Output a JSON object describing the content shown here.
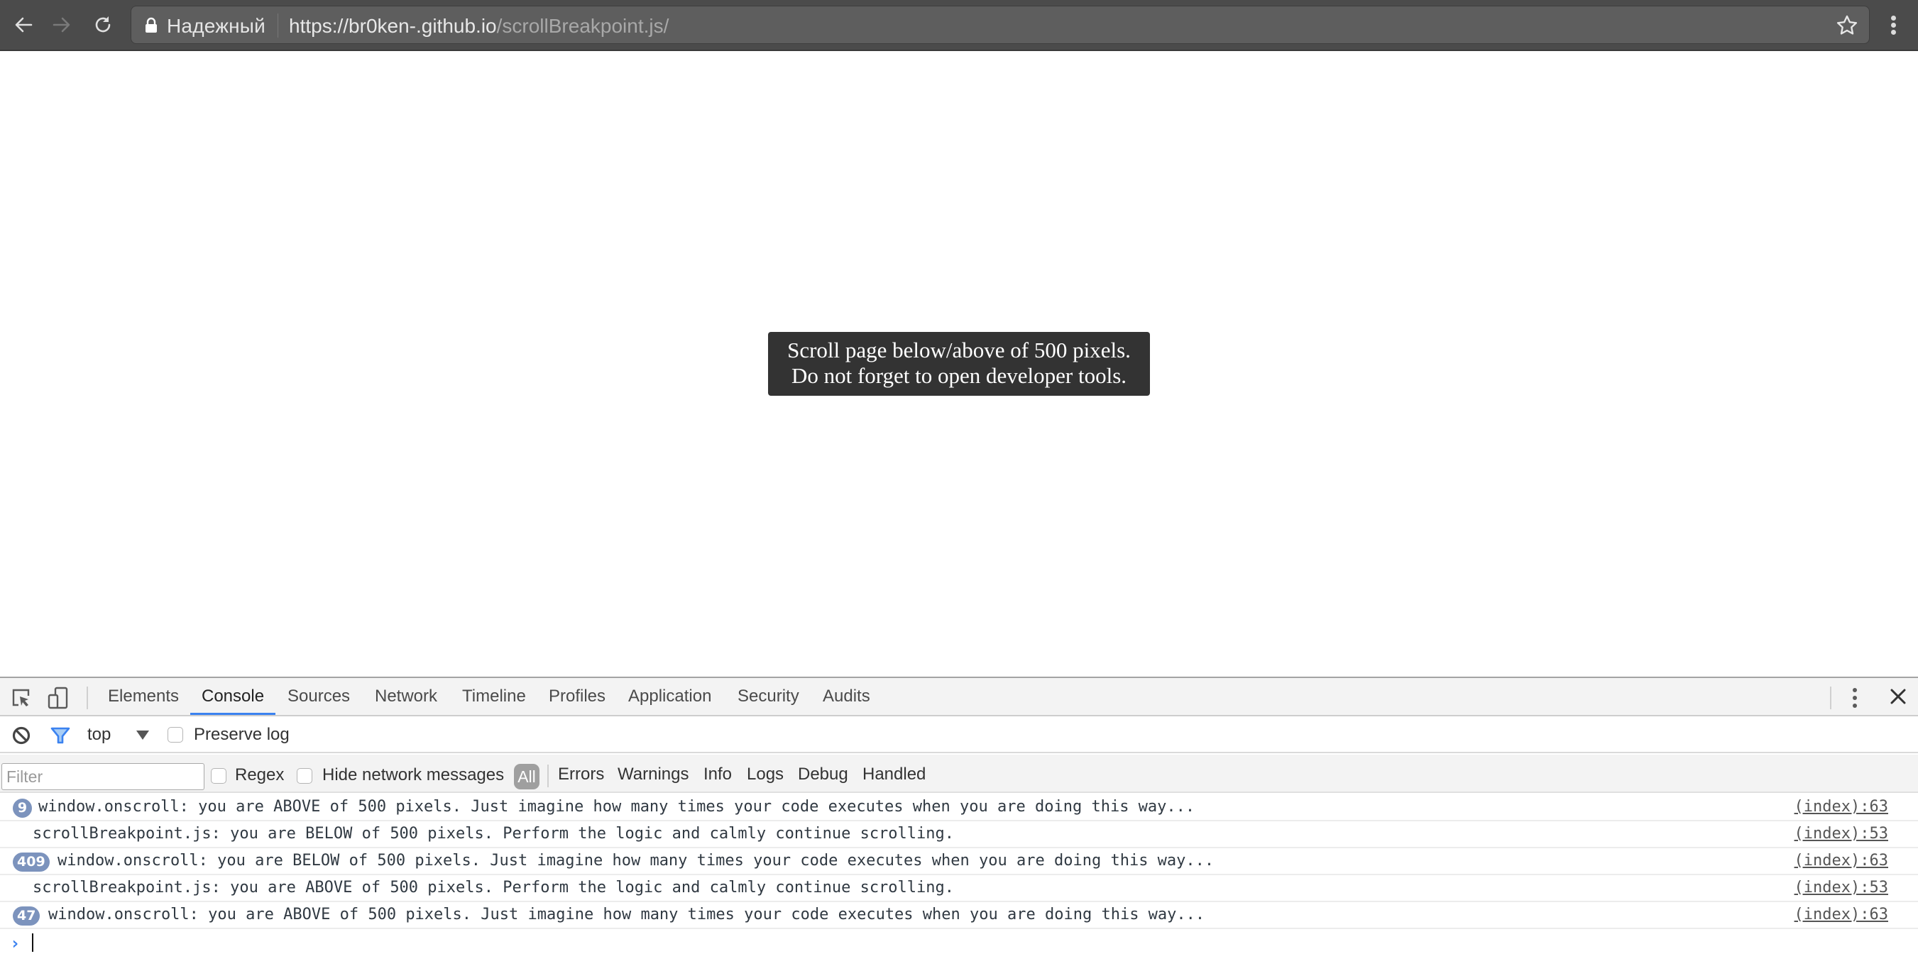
{
  "browser": {
    "secure_label": "Надежный",
    "url_host": "https://br0ken-.github.io",
    "url_path": "/scrollBreakpoint.js/",
    "icons": [
      "back-arrow-icon",
      "forward-arrow-icon",
      "reload-icon",
      "lock-icon",
      "bookmark-star-icon",
      "browser-menu-icon"
    ]
  },
  "page": {
    "message_line1": "Scroll page below/above of 500 pixels.",
    "message_line2": "Do not forget to open developer tools."
  },
  "devtools": {
    "tabs": [
      {
        "label": "Elements",
        "active": false
      },
      {
        "label": "Console",
        "active": true
      },
      {
        "label": "Sources",
        "active": false
      },
      {
        "label": "Network",
        "active": false
      },
      {
        "label": "Timeline",
        "active": false
      },
      {
        "label": "Profiles",
        "active": false
      },
      {
        "label": "Application",
        "active": false
      },
      {
        "label": "Security",
        "active": false
      },
      {
        "label": "Audits",
        "active": false
      }
    ],
    "accent_color": "#3b82f0",
    "toolbar": {
      "context": "top",
      "preserve_log_label": "Preserve log",
      "preserve_log_checked": false
    },
    "filterbar": {
      "filter_placeholder": "Filter",
      "filter_value": "",
      "regex_label": "Regex",
      "regex_checked": false,
      "hide_network_label": "Hide network messages",
      "hide_network_checked": false,
      "levels": [
        "All",
        "Errors",
        "Warnings",
        "Info",
        "Logs",
        "Debug",
        "Handled"
      ],
      "active_level": "All"
    },
    "messages": [
      {
        "count": "9",
        "text": "window.onscroll: you are ABOVE of 500 pixels. Just imagine how many times your code executes when you are doing this way...",
        "source": "(index):63"
      },
      {
        "count": "",
        "text": "scrollBreakpoint.js: you are BELOW of 500 pixels. Perform the logic and calmly continue scrolling.",
        "source": "(index):53"
      },
      {
        "count": "409",
        "text": "window.onscroll: you are BELOW of 500 pixels. Just imagine how many times your code executes when you are doing this way...",
        "source": "(index):63"
      },
      {
        "count": "",
        "text": "scrollBreakpoint.js: you are ABOVE of 500 pixels. Perform the logic and calmly continue scrolling.",
        "source": "(index):53"
      },
      {
        "count": "47",
        "text": "window.onscroll: you are ABOVE of 500 pixels. Just imagine how many times your code executes when you are doing this way...",
        "source": "(index):63"
      }
    ],
    "prompt_symbol": "›"
  }
}
